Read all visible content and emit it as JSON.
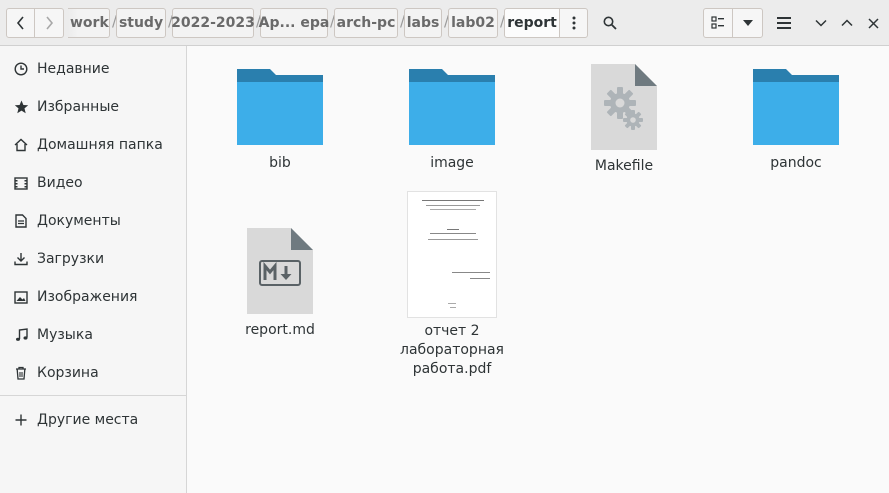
{
  "window": {
    "title": "report"
  },
  "breadcrumbs": [
    "work",
    "study",
    "2022-2023",
    "Ар... ера",
    "arch-pc",
    "labs",
    "lab02",
    "report"
  ],
  "toolbar": {
    "back_icon": "go-previous-icon",
    "forward_icon": "go-next-icon",
    "menu_icon": "view-more-icon",
    "search_icon": "search-icon",
    "view_icon": "view-list-icon",
    "view_dropdown_icon": "pan-down-icon",
    "hamburger_icon": "open-menu-icon",
    "minimize_icon": "minimize-icon",
    "maximize_icon": "maximize-icon",
    "close_icon": "close-icon"
  },
  "sidebar": {
    "items": [
      {
        "label": "Недавние",
        "icon": "clock-icon"
      },
      {
        "label": "Избранные",
        "icon": "star-icon"
      },
      {
        "label": "Домашняя папка",
        "icon": "home-icon"
      },
      {
        "label": "Видео",
        "icon": "video-icon"
      },
      {
        "label": "Документы",
        "icon": "document-icon"
      },
      {
        "label": "Загрузки",
        "icon": "download-icon"
      },
      {
        "label": "Изображения",
        "icon": "image-icon"
      },
      {
        "label": "Музыка",
        "icon": "music-icon"
      },
      {
        "label": "Корзина",
        "icon": "trash-icon"
      }
    ],
    "other": {
      "label": "Другие места",
      "icon": "plus-icon"
    }
  },
  "files": [
    {
      "name": "bib",
      "type": "folder"
    },
    {
      "name": "image",
      "type": "folder"
    },
    {
      "name": "Makefile",
      "type": "makefile"
    },
    {
      "name": "pandoc",
      "type": "folder"
    },
    {
      "name": "report.md",
      "type": "markdown"
    },
    {
      "name": "отчет 2 лабораторная работа.pdf",
      "type": "pdf"
    }
  ],
  "colors": {
    "folder": "#3daee9",
    "folder_tab": "#2a7fae",
    "doc": "#d6d6d6",
    "doc_fold": "#a8a8a8"
  }
}
